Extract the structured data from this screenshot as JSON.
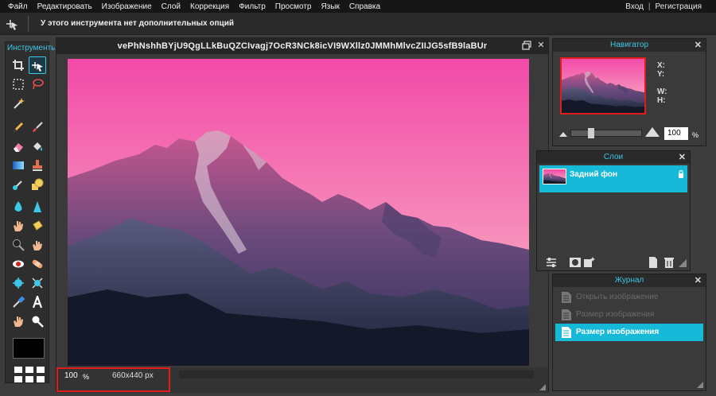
{
  "menu": {
    "items": [
      "Файл",
      "Редактировать",
      "Изображение",
      "Слой",
      "Коррекция",
      "Фильтр",
      "Просмотр",
      "Язык",
      "Справка"
    ],
    "login": "Вход",
    "separator": "|",
    "register": "Регистрация"
  },
  "options_bar": {
    "message": "У этого инструмента нет дополнительных опций"
  },
  "tools": {
    "title": "Инструменты",
    "active_tool": "move-tool",
    "primary_color": "#000000"
  },
  "document": {
    "title": "vePhNshhBYjU9QgLLkBuQZCIvagj7OcR3NCk8icVI9WXllz0JMMhMlvcZIIJG5sfB9laBUr",
    "zoom": "100",
    "zoom_unit": "%",
    "dimensions": "660x440 px",
    "close_symbol": "✕"
  },
  "navigator": {
    "title": "Навигатор",
    "close_symbol": "✕",
    "x_label": "X:",
    "y_label": "Y:",
    "w_label": "W:",
    "h_label": "H:",
    "zoom": "100",
    "zoom_unit": "%",
    "zoom_level": 0.25
  },
  "layers": {
    "title": "Слои",
    "close_symbol": "✕",
    "items": [
      {
        "name": "Задний фон",
        "locked": true,
        "selected": true
      }
    ]
  },
  "history": {
    "title": "Журнал",
    "close_symbol": "✕",
    "items": [
      {
        "label": "Открыть изображение",
        "current": false
      },
      {
        "label": "Размер изображения",
        "current": false
      },
      {
        "label": "Размер изображения",
        "current": true
      }
    ]
  },
  "colors": {
    "accent": "#17b9d8",
    "highlight_border": "#e21c1c",
    "sky_top": "#f357ae",
    "sky_bottom": "#f7b9c2"
  }
}
